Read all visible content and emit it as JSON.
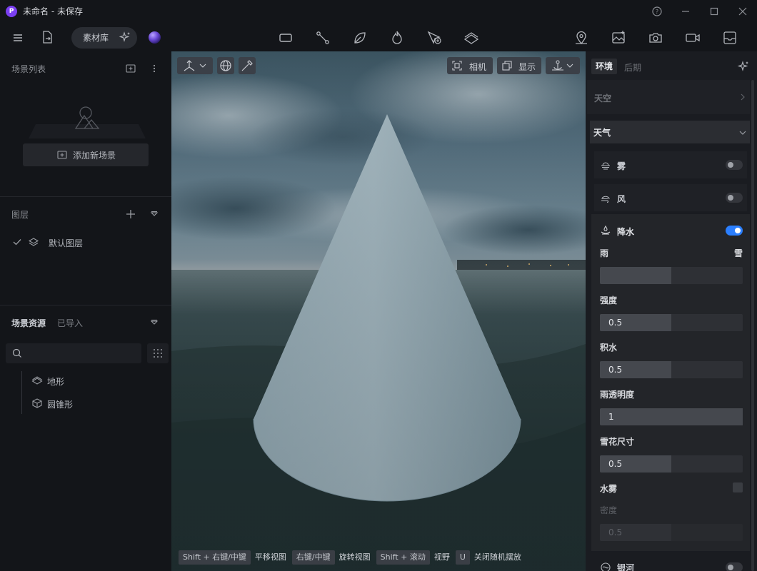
{
  "window": {
    "logo_letter": "P",
    "title": "未命名 - 未保存"
  },
  "toolbar": {
    "asset_library_label": "素材库",
    "center_icons": [
      "rectangle-icon",
      "path-icon",
      "leaf-icon",
      "fire-icon",
      "cursor-add-icon",
      "terrain-icon"
    ],
    "right_icons": [
      "location-pin-icon",
      "image-add-icon",
      "camera-icon",
      "video-icon",
      "tray-icon"
    ]
  },
  "left_panel": {
    "scene_list": {
      "title": "场景列表",
      "add_button_label": "添加新场景"
    },
    "layers": {
      "title": "图层",
      "items": [
        {
          "label": "默认图层",
          "checked": true
        }
      ]
    },
    "scene_assets": {
      "title": "场景资源",
      "tab_imported": "已导入",
      "search_placeholder": "",
      "items": [
        {
          "label": "地形",
          "icon": "terrain-icon"
        },
        {
          "label": "圆锥形",
          "icon": "cube-icon"
        }
      ]
    }
  },
  "viewport": {
    "camera_label": "相机",
    "display_label": "显示",
    "shortcuts": [
      {
        "key": "Shift + 右键/中键",
        "action": "平移视图"
      },
      {
        "key": "右键/中键",
        "action": "旋转视图"
      },
      {
        "key": "Shift + 滚动",
        "action": "视野"
      },
      {
        "key": "U",
        "action": "关闭随机摆放"
      }
    ]
  },
  "right_panel": {
    "tabs": {
      "environment": "环境",
      "post": "后期"
    },
    "sky_label": "天空",
    "weather_label": "天气",
    "fog": {
      "label": "雾",
      "enabled": false
    },
    "wind": {
      "label": "风",
      "enabled": false
    },
    "precipitation": {
      "label": "降水",
      "enabled": true,
      "rain_label": "雨",
      "snow_label": "雪",
      "rain_snow_mix": 0.5,
      "intensity": {
        "label": "强度",
        "value": "0.5",
        "fraction": 0.5
      },
      "puddles": {
        "label": "积水",
        "value": "0.5",
        "fraction": 0.5
      },
      "rain_opacity": {
        "label": "雨透明度",
        "value": "1",
        "fraction": 1.0
      },
      "snowflake_size": {
        "label": "雪花尺寸",
        "value": "0.5",
        "fraction": 0.5
      },
      "water_fog": {
        "label": "水雾",
        "checked": false
      },
      "density": {
        "label": "密度",
        "value": "0.5",
        "fraction": 0.5,
        "disabled": true
      }
    },
    "galaxy": {
      "label": "银河",
      "enabled": false
    }
  },
  "colors": {
    "accent": "#2b7fff",
    "logo": "#7b3ff2",
    "panel_bg": "#131519"
  }
}
